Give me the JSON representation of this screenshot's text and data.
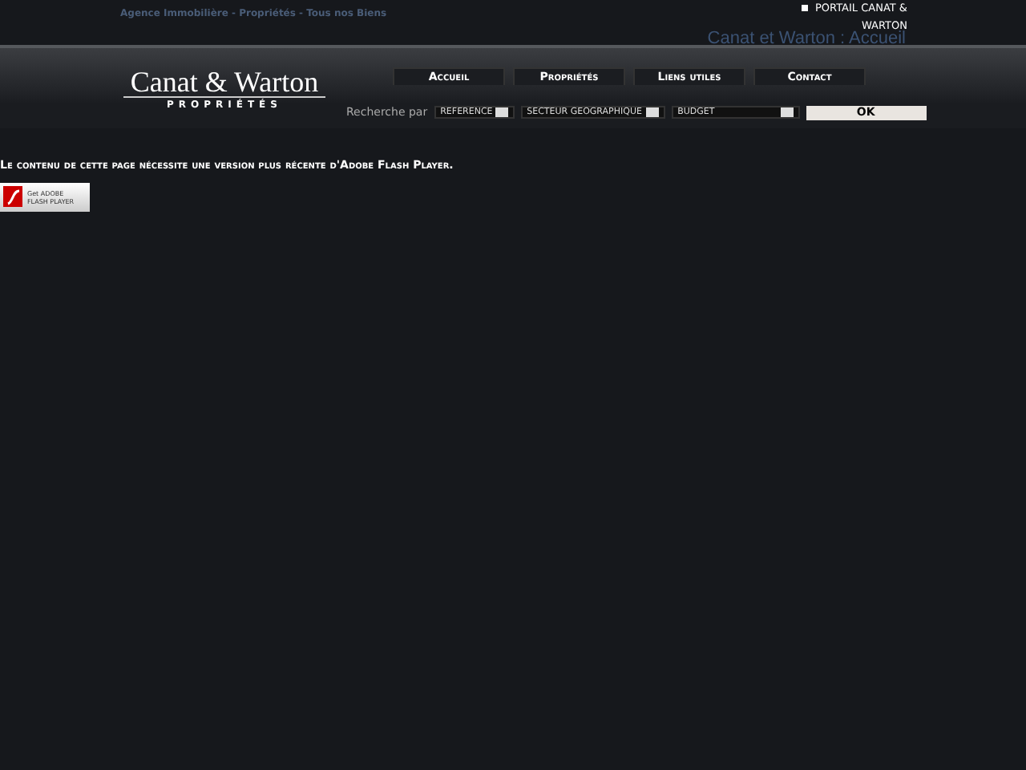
{
  "top_bar": {
    "tagline": "Agence Immobilière - Propriétés - Tous nos Biens",
    "portal_link": "PORTAIL CANAT & WARTON",
    "page_title": "Canat et Warton : Accueil"
  },
  "logo": {
    "name": "Canat & Warton",
    "subtitle": "PROPRIÉTÉS"
  },
  "nav": [
    {
      "label": "Accueil"
    },
    {
      "label": "Propriétés"
    },
    {
      "label": "Liens utiles"
    },
    {
      "label": "Contact"
    }
  ],
  "search": {
    "label": "Recherche par",
    "selects": [
      "REFERENCE",
      "SECTEUR GEOGRAPHIQUE",
      "BUDGET"
    ],
    "button": "OK"
  },
  "message": "Le contenu de cette page nécessite une version plus récente d'Adobe Flash Player.",
  "flash_badge": {
    "line_1": "Get ADOBE",
    "line_2": "FLASH PLAYER"
  }
}
